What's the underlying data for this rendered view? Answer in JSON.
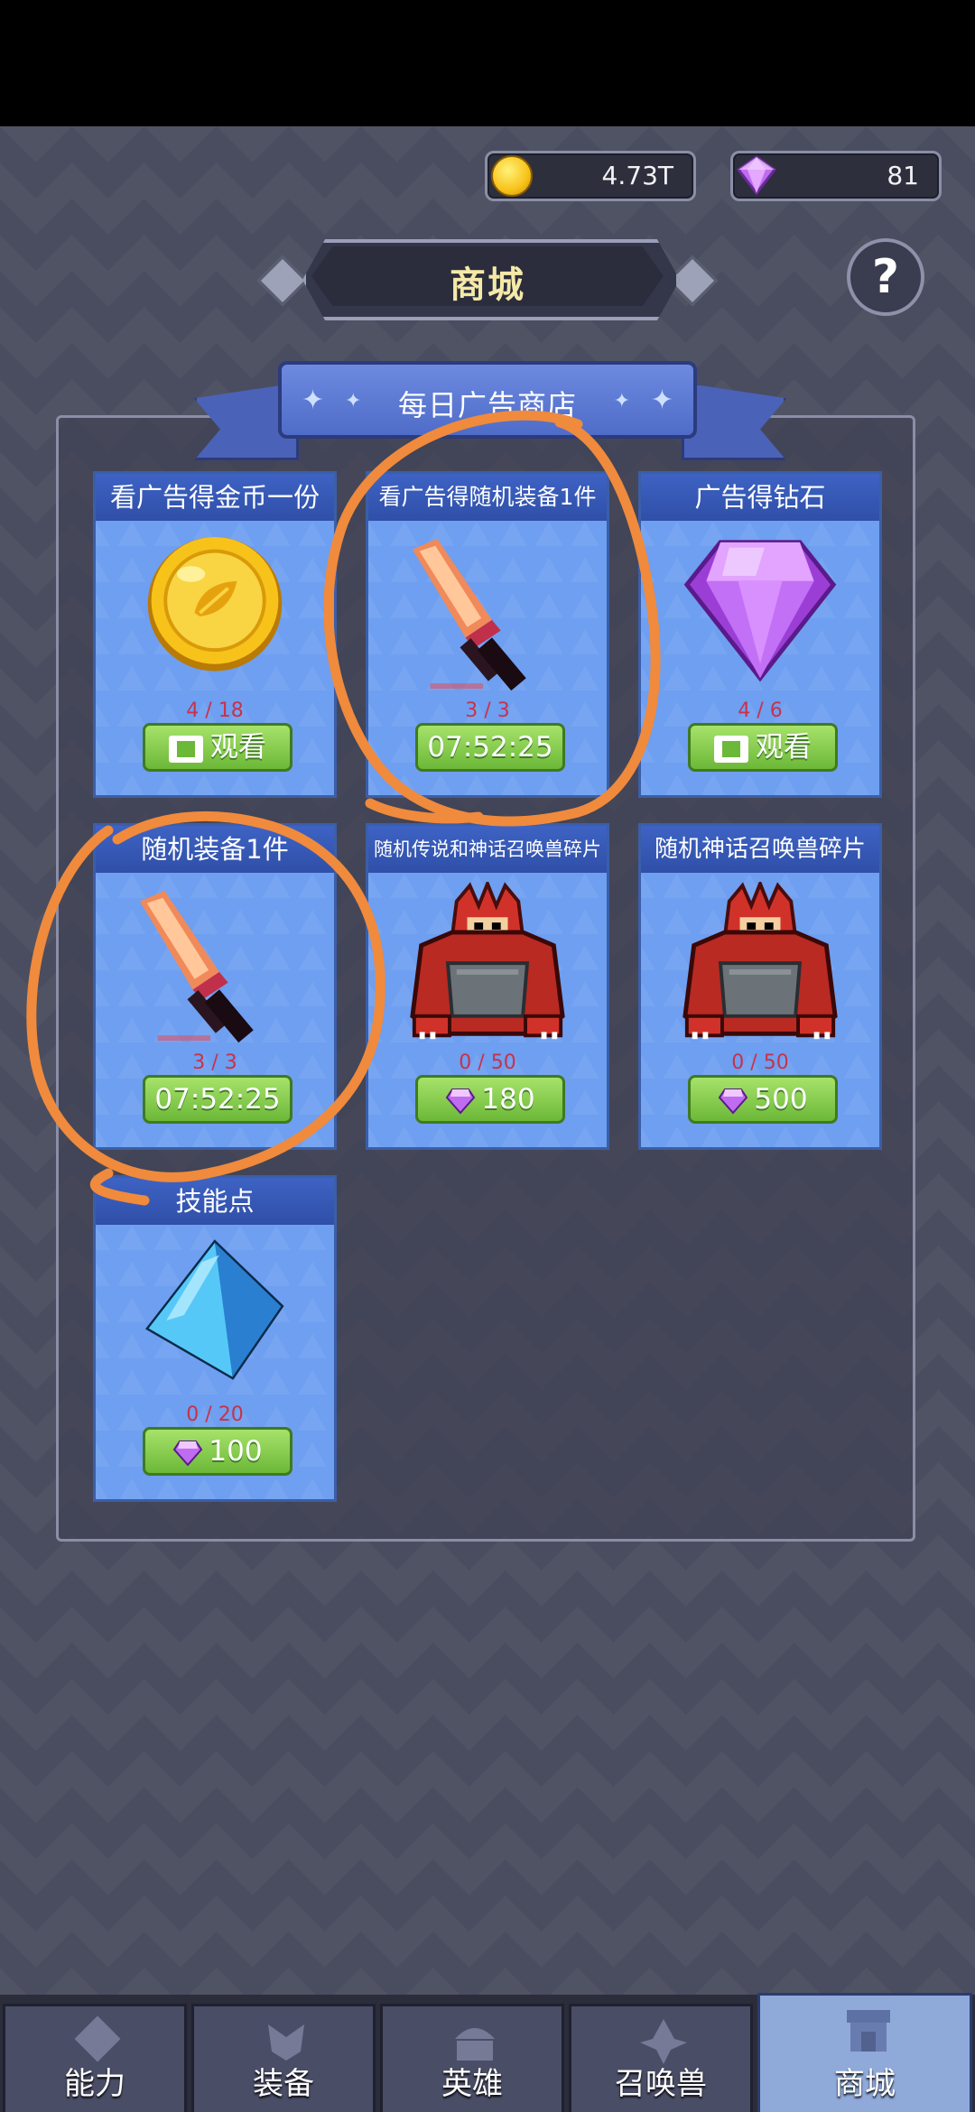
{
  "currency": {
    "gold": "4.73T",
    "gems": "81"
  },
  "header": {
    "title": "商城",
    "help": "?"
  },
  "shop": {
    "section_title": "每日广告商店",
    "items": [
      {
        "title": "看广告得金币一份",
        "count": "4 / 18",
        "button": "观看",
        "art": "gold-coin"
      },
      {
        "title": "看广告得随机装备1件",
        "count": "3 / 3",
        "button": "07:52:25",
        "art": "flame-sword"
      },
      {
        "title": "广告得钻石",
        "count": "4 / 6",
        "button": "观看",
        "art": "purple-gem"
      },
      {
        "title": "随机装备1件",
        "count": "3 / 3",
        "button": "07:52:25",
        "art": "flame-sword"
      },
      {
        "title": "随机传说和神话召唤兽碎片",
        "count": "0 / 50",
        "button": "180",
        "art": "red-beast"
      },
      {
        "title": "随机神话召唤兽碎片",
        "count": "0 / 50",
        "button": "500",
        "art": "red-beast"
      },
      {
        "title": "技能点",
        "count": "0 / 20",
        "button": "100",
        "art": "blue-crystal"
      }
    ]
  },
  "nav": {
    "tabs": [
      {
        "label": "能力",
        "icon": "ability-icon"
      },
      {
        "label": "装备",
        "icon": "equipment-icon"
      },
      {
        "label": "英雄",
        "icon": "hero-icon"
      },
      {
        "label": "召唤兽",
        "icon": "summon-icon"
      },
      {
        "label": "商城",
        "icon": "shop-icon"
      }
    ],
    "active": "商城"
  },
  "colors": {
    "card_bg": "#6e9ff0",
    "card_header": "#3e63c4",
    "button_green": "#8ccf4f",
    "count_red": "#c8324a",
    "annotation_orange": "#f08a3c"
  }
}
